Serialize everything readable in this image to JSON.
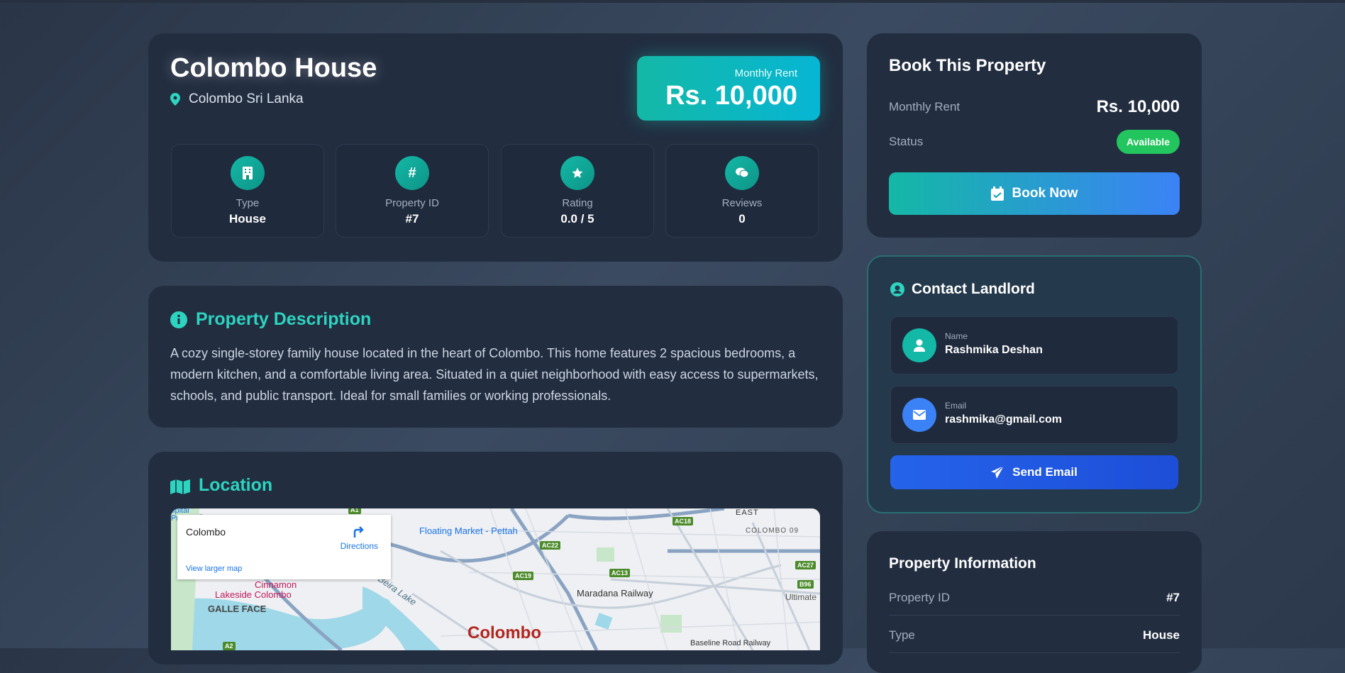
{
  "property": {
    "title": "Colombo House",
    "location": "Colombo Sri Lanka",
    "rent_label": "Monthly Rent",
    "rent_value": "Rs. 10,000",
    "stats": [
      {
        "icon": "building-icon",
        "label": "Type",
        "value": "House"
      },
      {
        "icon": "hash-icon",
        "label": "Property ID",
        "value": "#7"
      },
      {
        "icon": "star-icon",
        "label": "Rating",
        "value": "0.0 / 5"
      },
      {
        "icon": "chat-icon",
        "label": "Reviews",
        "value": "0"
      }
    ]
  },
  "description": {
    "title": "Property Description",
    "text": "A cozy single-storey family house located in the heart of Colombo. This home features 2 spacious bedrooms, a modern kitchen, and a comfortable living area. Situated in a quiet neighborhood with easy access to supermarkets, schools, and public transport. Ideal for small families or working professionals."
  },
  "location": {
    "title": "Location",
    "map": {
      "place_name": "Colombo",
      "directions": "Directions",
      "view_larger": "View larger map",
      "labels": {
        "floating_market": "Floating Market - Pettah",
        "cinnamon": "Cinnamon",
        "lakeside": "Lakeside Colombo",
        "galle_face": "GALLE FACE",
        "beira_lake": "Beira Lake",
        "maradana": "Maradana Railway",
        "colombo_big": "Colombo",
        "east": "EAST",
        "colombo09": "COLOMBO 09",
        "baseline": "Baseline Road Railway",
        "ultimate": "Ultimate",
        "spital": "spital",
        "pre": "Pre"
      },
      "roads": [
        "AC18",
        "AC22",
        "AC19",
        "AC13",
        "AC27",
        "B96",
        "A1",
        "A2"
      ]
    }
  },
  "booking": {
    "title": "Book This Property",
    "rent_label": "Monthly Rent",
    "rent_value": "Rs. 10,000",
    "status_label": "Status",
    "status_value": "Available",
    "button": "Book Now"
  },
  "contact": {
    "title": "Contact Landlord",
    "name_label": "Name",
    "name_value": "Rashmika Deshan",
    "email_label": "Email",
    "email_value": "rashmika@gmail.com",
    "button": "Send Email"
  },
  "info": {
    "title": "Property Information",
    "rows": [
      {
        "label": "Property ID",
        "value": "#7"
      },
      {
        "label": "Type",
        "value": "House"
      }
    ]
  },
  "colors": {
    "accent": "#2dd4bf",
    "available": "#22c55e",
    "email_button": "#2563eb"
  }
}
